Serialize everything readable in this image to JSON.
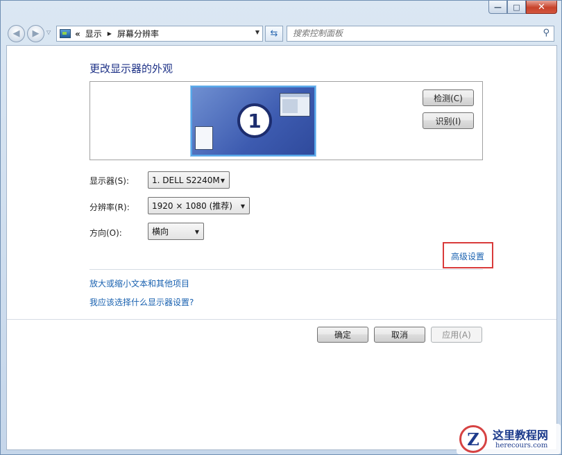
{
  "window": {
    "minimize_glyph": "—",
    "maximize_glyph": "□",
    "close_glyph": "✕"
  },
  "nav": {
    "back_icon": "back-arrow-icon",
    "forward_icon": "forward-arrow-icon",
    "breadcrumb_prefix": "«",
    "breadcrumbs": [
      "显示",
      "屏幕分辨率"
    ],
    "search_placeholder": "搜索控制面板"
  },
  "main": {
    "heading": "更改显示器的外观",
    "monitor_number": "1",
    "detect_label": "检测(C)",
    "identify_label": "识别(I)",
    "display_label": "显示器(S):",
    "display_value": "1. DELL S2240M",
    "resolution_label": "分辨率(R):",
    "resolution_value": "1920 × 1080 (推荐)",
    "orientation_label": "方向(O):",
    "orientation_value": "横向",
    "advanced_link": "高级设置",
    "link_text_size": "放大或缩小文本和其他项目",
    "link_which_settings": "我应该选择什么显示器设置?"
  },
  "buttons": {
    "ok": "确定",
    "cancel": "取消",
    "apply": "应用(A)"
  },
  "watermark": {
    "logo_letter": "Z",
    "title": "这里教程网",
    "url": "herecours.com"
  },
  "colors": {
    "link": "#1a62b0",
    "heading": "#1e3287",
    "highlight": "#d93a3a"
  }
}
